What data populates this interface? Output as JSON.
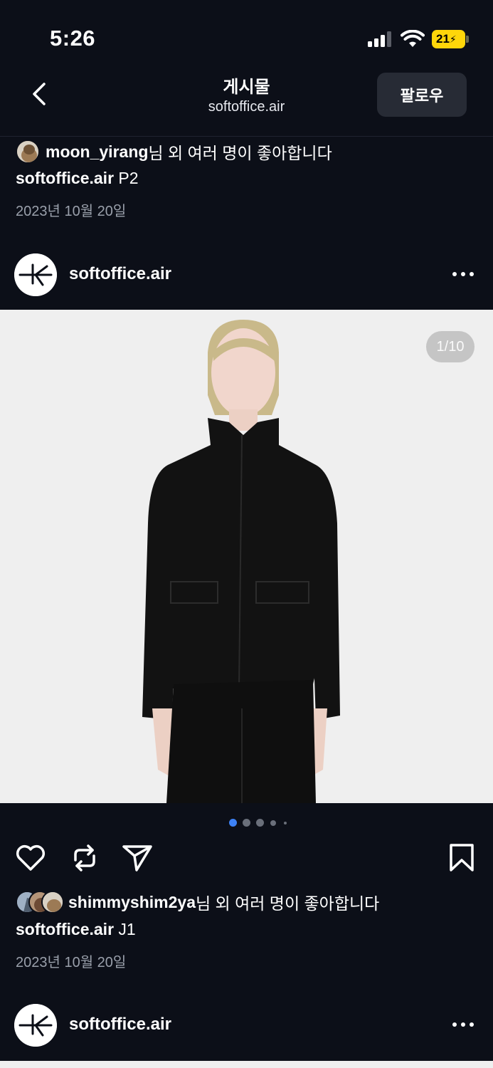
{
  "status_bar": {
    "time": "5:26",
    "battery": "21"
  },
  "header": {
    "title": "게시물",
    "subtitle": "softoffice.air",
    "follow_label": "팔로우"
  },
  "prev_post": {
    "liked_by_user": "moon_yirang",
    "liked_by_suffix": "님 외 여러 명이 좋아합니다",
    "caption_user": "softoffice.air",
    "caption_text": " P2",
    "date": "2023년 10월 20일"
  },
  "post": {
    "username": "softoffice.air",
    "counter": "1/10",
    "liked_by_user": "shimmyshim2ya",
    "liked_by_suffix": "님 외 여러 명이 좋아합니다",
    "caption_user": "softoffice.air",
    "caption_text": " J1",
    "date": "2023년 10월 20일",
    "carousel_index": 1,
    "carousel_total": 10
  },
  "next_post": {
    "username": "softoffice.air"
  },
  "icons": {
    "like": "heart-icon",
    "repost": "repost-icon",
    "share": "send-icon",
    "save": "bookmark-icon"
  },
  "colors": {
    "background": "#0c0f18",
    "accent": "#3d82f6",
    "battery": "#ffd60a"
  }
}
